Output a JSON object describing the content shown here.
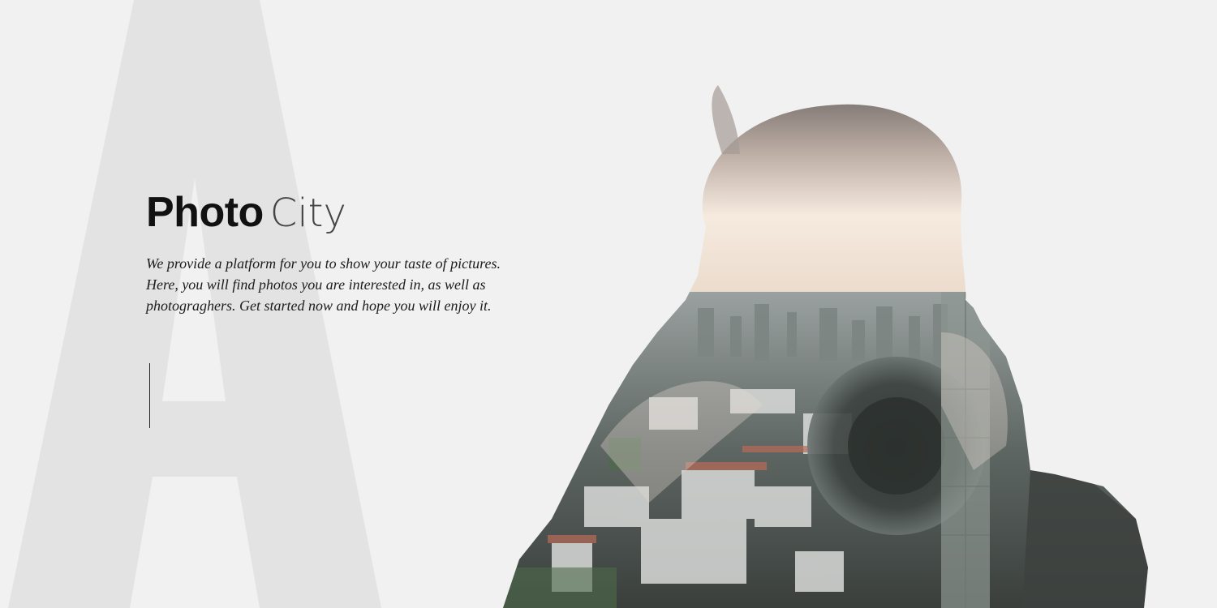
{
  "hero": {
    "title_strong": "Photo",
    "title_light": "City",
    "tagline": "We provide a platform for you to show your taste of pictures. Here, you will find photos you are interested in, as well as photograghers. Get started now and hope you will enjoy it."
  },
  "background": {
    "letter": "A"
  },
  "image": {
    "icon": "double-exposure-photographer-image"
  },
  "colors": {
    "background": "#f1f1f1",
    "letter": "#e2e2e2",
    "text": "#111111"
  }
}
